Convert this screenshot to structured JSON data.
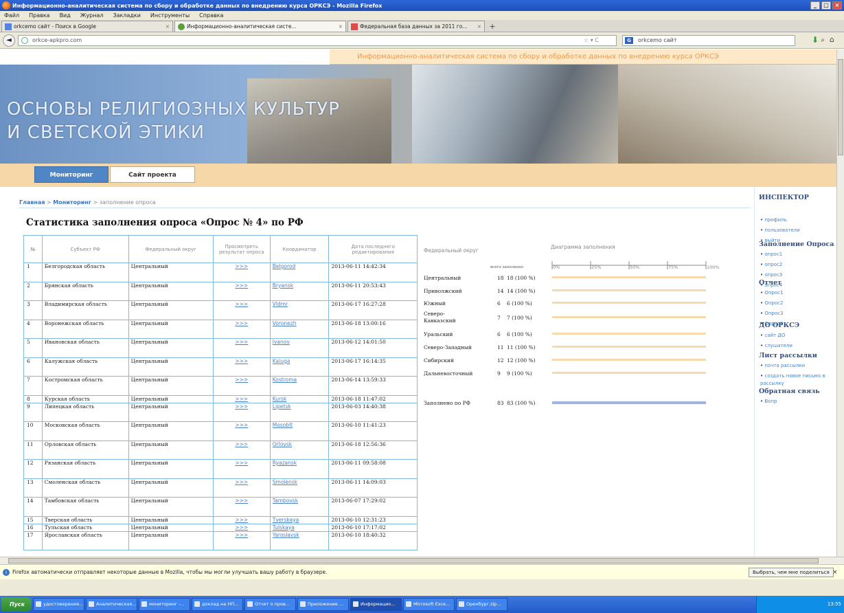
{
  "window": {
    "title": "Информационно-аналитическая система по сбору и обработке данных по внедрению курса ОРКСЭ - Mozilla Firefox",
    "buttons": [
      "_",
      "□",
      "×"
    ]
  },
  "menu": [
    "Файл",
    "Правка",
    "Вид",
    "Журнал",
    "Закладки",
    "Инструменты",
    "Справка"
  ],
  "tabs": [
    {
      "label": "orkcemo сайт - Поиск в Google"
    },
    {
      "label": "Информационно-аналитическая систе..."
    },
    {
      "label": "Федеральная база данных за 2011 го..."
    }
  ],
  "nav": {
    "url": "orkce-apkpro.com",
    "search_engine": "G",
    "search_value": "orkcemo сайт"
  },
  "site": {
    "top_strip": "Информационно-аналитическая система по сбору и обработке данных по внедрению курса ОРКСЭ",
    "banner_line1": "ОСНОВЫ РЕЛИГИОЗНЫХ КУЛЬТУР",
    "banner_line2": "И СВЕТСКОЙ ЭТИКИ",
    "tab_monitoring": "Мониторинг",
    "tab_site": "Сайт проекта"
  },
  "breadcrumb": {
    "home": "Главная",
    "sep": " > ",
    "monitoring": "Мониторинг",
    "current": "заполнение опроса"
  },
  "page_title": "Статистика заполнения опроса «Опрос № 4» по РФ",
  "table": {
    "headers": [
      "№",
      "Субъект РФ",
      "Федеральный округ",
      "Просмотреть результат опроса",
      "Координатор",
      "Дата последнего редактирования"
    ],
    "view_text": ">>>",
    "rows": [
      {
        "n": "1",
        "subject": "Белгородская область",
        "district": "Центральный",
        "coord": "Belgorod",
        "date": "2013-06-11 14:42:34"
      },
      {
        "n": "2",
        "subject": "Брянская область",
        "district": "Центральный",
        "coord": "Bryansk",
        "date": "2013-06-11 20:53:43"
      },
      {
        "n": "3",
        "subject": "Владимирская область",
        "district": "Центральный",
        "coord": "Vldmr",
        "date": "2013-06-17 16:27:28"
      },
      {
        "n": "4",
        "subject": "Воронежская область",
        "district": "Центральный",
        "coord": "Voronezh",
        "date": "2013-06-18 13:00:16"
      },
      {
        "n": "5",
        "subject": "Ивановская область",
        "district": "Центральный",
        "coord": "Ivanov",
        "date": "2013-06-12 14:01:50"
      },
      {
        "n": "6",
        "subject": "Калужская область",
        "district": "Центральный",
        "coord": "Kaluga",
        "date": "2013-06-17 16:14:35"
      },
      {
        "n": "7",
        "subject": "Костромская область",
        "district": "Центральный",
        "coord": "Kostroma",
        "date": "2013-06-14 13:59:33"
      },
      {
        "n": "8",
        "subject": "Курская область",
        "district": "Центральный",
        "coord": "Kursk",
        "date": "2013-06-18 11:47:02",
        "short": true
      },
      {
        "n": "9",
        "subject": "Липецкая область",
        "district": "Центральный",
        "coord": "Lipetsk",
        "date": "2013-06-03 14:40:38"
      },
      {
        "n": "10",
        "subject": "Московская область",
        "district": "Центральный",
        "coord": "Mosoblt",
        "date": "2013-06-10 11:41:23"
      },
      {
        "n": "11",
        "subject": "Орловская область",
        "district": "Центральный",
        "coord": "Orlovsk",
        "date": "2013-06-18 12:56:36"
      },
      {
        "n": "12",
        "subject": "Рязанская область",
        "district": "Центральный",
        "coord": "Ryazansk",
        "date": "2013-06-11 09:58:08"
      },
      {
        "n": "13",
        "subject": "Смоленская область",
        "district": "Центральный",
        "coord": "Smolensk",
        "date": "2013-06-11 14:09:03"
      },
      {
        "n": "14",
        "subject": "Тамбовская область",
        "district": "Центральный",
        "coord": "Tambovsk",
        "date": "2013-06-07 17:29:02"
      },
      {
        "n": "15",
        "subject": "Тверская область",
        "district": "Центральный",
        "coord": "Tverskaya",
        "date": "2013-06-10 12:31:23",
        "short": true
      },
      {
        "n": "16",
        "subject": "Тульская область",
        "district": "Центральный",
        "coord": "Tulskaya",
        "date": "2013-06-10 17:17:02",
        "short": true
      },
      {
        "n": "17",
        "subject": "Ярославская область",
        "district": "Центральный",
        "coord": "Yaroslavsk",
        "date": "2013-06-10 18:40:32"
      }
    ]
  },
  "chart_data": {
    "type": "bar",
    "title": "Диаграмма заполнения",
    "xlabel": "Федеральный округ",
    "col_headers": "всего заполнено",
    "xlim": [
      0,
      100
    ],
    "ticks": [
      "0%",
      "25%",
      "50%",
      "75%",
      "100%"
    ],
    "categories": [
      "Центральный",
      "Приволжский",
      "Южный",
      "Северо-Кавказский",
      "Уральский",
      "Северо-Западный",
      "Сибирский",
      "Дальневосточный"
    ],
    "totals": [
      "18",
      "14",
      "6",
      "7",
      "6",
      "11",
      "12",
      "9"
    ],
    "filled": [
      "18 (100 %)",
      "14 (100 %)",
      "6 (100 %)",
      "7 (100 %)",
      "6 (100 %)",
      "11 (100 %)",
      "12 (100 %)",
      "9 (100 %)"
    ],
    "values": [
      100,
      100,
      100,
      100,
      100,
      100,
      100,
      100
    ],
    "total": {
      "label": "Заполнено по РФ",
      "count": "83",
      "filled": "83 (100 %)",
      "value": 100
    },
    "colors": {
      "district_bar": "#f6d9ac",
      "total_bar": "#9fb5de"
    }
  },
  "sidebar": {
    "groups": [
      {
        "title": "ИНСПЕКТОР",
        "items": [
          "профиль",
          "пользователи",
          "выйти"
        ]
      },
      {
        "title": "Заполнение Опроса",
        "items": [
          "опрос1",
          "опрос2",
          "опрос3",
          "опрос4"
        ]
      },
      {
        "title": "Отчет",
        "items": [
          "Опрос1",
          "Опрос2",
          "Опрос3",
          "Опрос4"
        ]
      },
      {
        "title": "ДО ОРКСЭ",
        "items": [
          "сайт ДО",
          "слушатели"
        ]
      },
      {
        "title": "Лист рассылки",
        "items": [
          "почта рассылки",
          "создать новое письмо в рассылку"
        ]
      },
      {
        "title": "Обратная связь",
        "items": [
          "Вопр"
        ]
      }
    ]
  },
  "notification": {
    "text": "Firefox автоматически отправляет некоторые данные в Mozilla, чтобы мы могли улучшать вашу работу в браузере.",
    "button": "Выбрать, чем мне поделиться"
  },
  "taskbar": {
    "start": "Пуск",
    "tasks": [
      "удостоверения...",
      "Аналитическая...",
      "мониторинг -...",
      "доклад на НП...",
      "Отчет о пров...",
      "Приложение ...",
      "Информацио...",
      "Microsoft Exce...",
      "Оренбург.zip..."
    ],
    "clock": "13:55"
  }
}
